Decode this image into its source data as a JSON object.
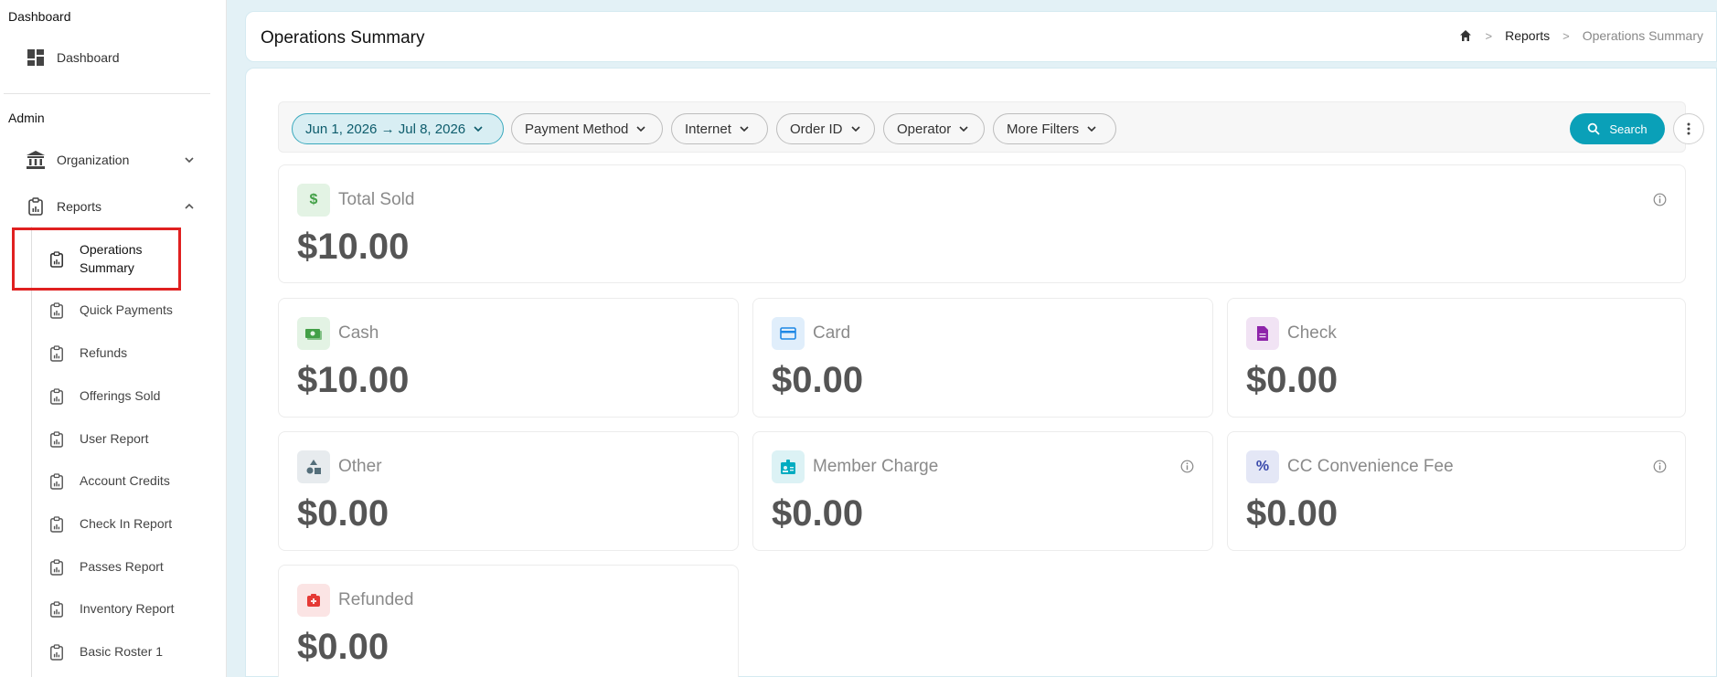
{
  "sidebar": {
    "section_dashboard": "Dashboard",
    "dashboard_item": "Dashboard",
    "section_admin": "Admin",
    "organization": "Organization",
    "reports": "Reports",
    "sub_items": [
      {
        "label": "Operations Summary",
        "line1": "Operations",
        "line2": "Summary"
      },
      {
        "label": "Quick Payments"
      },
      {
        "label": "Refunds"
      },
      {
        "label": "Offerings Sold"
      },
      {
        "label": "User Report"
      },
      {
        "label": "Account Credits"
      },
      {
        "label": "Check In Report"
      },
      {
        "label": "Passes Report"
      },
      {
        "label": "Inventory Report"
      },
      {
        "label": "Basic Roster 1"
      }
    ]
  },
  "header": {
    "title": "Operations Summary",
    "breadcrumb": {
      "reports": "Reports",
      "current": "Operations Summary"
    }
  },
  "filters": {
    "date_range": "Jun 1, 2026 → Jul 8, 2026",
    "payment_method": "Payment Method",
    "internet": "Internet",
    "order_id": "Order ID",
    "operator": "Operator",
    "more_filters": "More Filters",
    "search": "Search"
  },
  "stats": {
    "total_sold": {
      "title": "Total Sold",
      "value": "$10.00",
      "color": "#43a047"
    },
    "cash": {
      "title": "Cash",
      "value": "$10.00",
      "color": "#43a047"
    },
    "card": {
      "title": "Card",
      "value": "$0.00",
      "color": "#1e88e5"
    },
    "check": {
      "title": "Check",
      "value": "$0.00",
      "color": "#8e24aa"
    },
    "other": {
      "title": "Other",
      "value": "$0.00",
      "color": "#546e7a"
    },
    "member_charge": {
      "title": "Member Charge",
      "value": "$0.00",
      "color": "#00acc1"
    },
    "cc_fee": {
      "title": "CC Convenience Fee",
      "value": "$0.00",
      "color": "#3949ab"
    },
    "refunded": {
      "title": "Refunded",
      "value": "$0.00",
      "color": "#e53935"
    }
  }
}
